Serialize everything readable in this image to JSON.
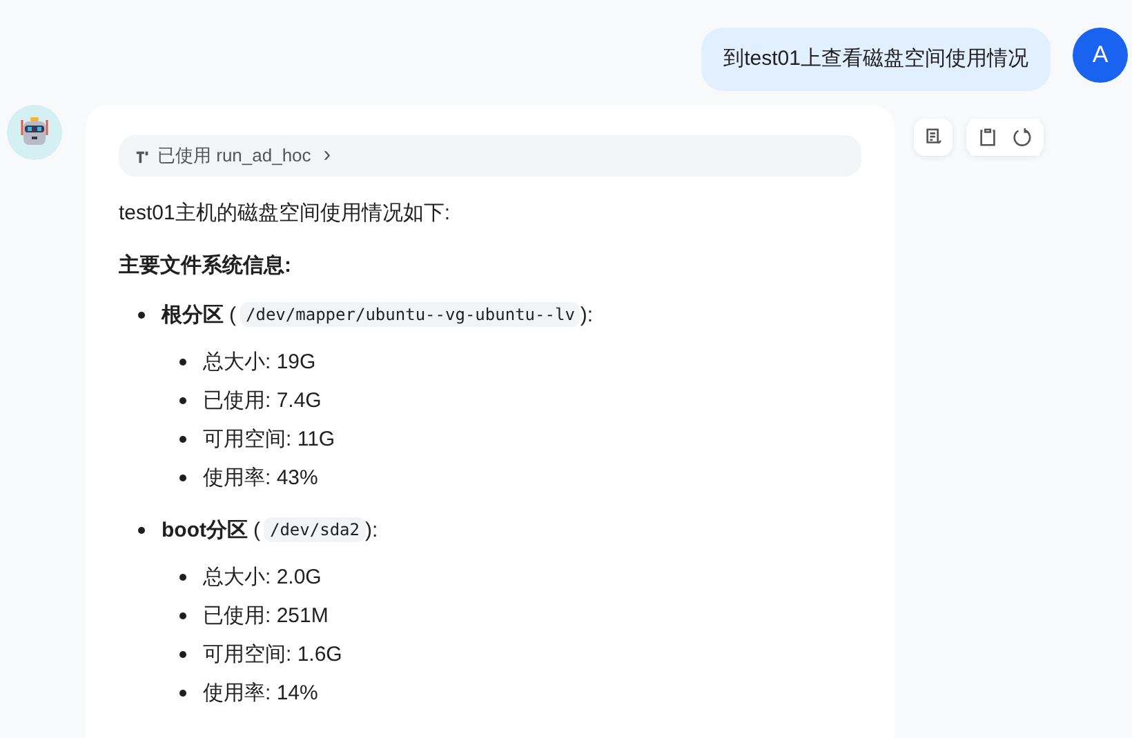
{
  "user_message": {
    "text": "到test01上查看磁盘空间使用情况",
    "avatar": "A"
  },
  "reply": {
    "tool_chip": {
      "label": "已使用 run_ad_hoc",
      "chevron": "›"
    },
    "intro": "test01主机的磁盘空间使用情况如下:",
    "heading": "主要文件系统信息:",
    "partitions": [
      {
        "name": "根分区",
        "open": "(",
        "path": "/dev/mapper/ubuntu--vg-ubuntu--lv",
        "close": "):",
        "items": [
          "总大小: 19G",
          "已使用: 7.4G",
          "可用空间: 11G",
          "使用率: 43%"
        ]
      },
      {
        "name": "boot分区",
        "open": "(",
        "path": "/dev/sda2",
        "close": "):",
        "items": [
          "总大小: 2.0G",
          "已使用: 251M",
          "可用空间: 1.6G",
          "使用率: 14%"
        ]
      }
    ]
  }
}
